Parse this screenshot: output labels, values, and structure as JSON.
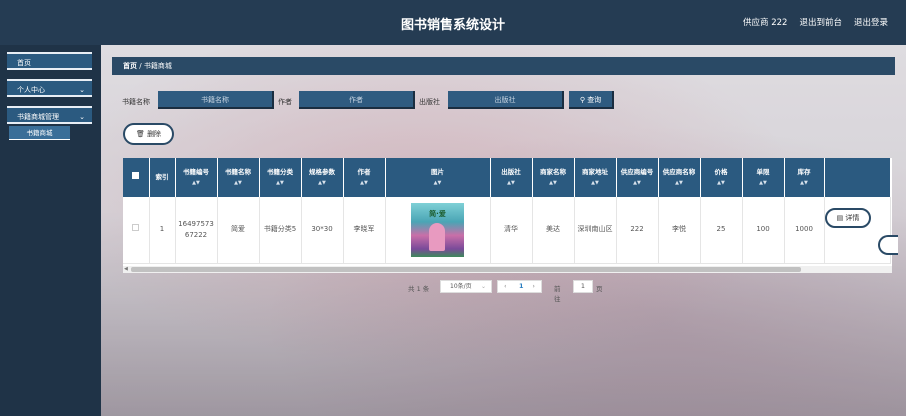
{
  "header": {
    "title": "图书销售系统设计",
    "user": "供应商 222",
    "backend_link": "退出到前台",
    "logout_link": "退出登录"
  },
  "sidebar": {
    "items": [
      {
        "label": "首页",
        "has_chevron": false
      },
      {
        "label": "个人中心",
        "has_chevron": true
      },
      {
        "label": "书籍商城管理",
        "has_chevron": true
      }
    ],
    "sub_items": [
      {
        "label": "书籍商城"
      }
    ]
  },
  "breadcrumb": {
    "home": "首页",
    "separator": "/",
    "current": "书籍商城"
  },
  "search": {
    "book_name_label": "书籍名称",
    "book_name_placeholder": "书籍名称",
    "author_label": "作者",
    "author_placeholder": "作者",
    "publisher_label": "出版社",
    "publisher_placeholder": "出版社",
    "search_button": "查询"
  },
  "actions": {
    "delete_button": "删除",
    "detail_button": "详情"
  },
  "table": {
    "columns": [
      {
        "label": "索引",
        "sortable": false
      },
      {
        "label": "书籍编号",
        "sortable": true
      },
      {
        "label": "书籍名称",
        "sortable": true
      },
      {
        "label": "书籍分类",
        "sortable": true
      },
      {
        "label": "规格参数",
        "sortable": true
      },
      {
        "label": "作者",
        "sortable": true
      },
      {
        "label": "图片",
        "sortable": true
      },
      {
        "label": "出版社",
        "sortable": true
      },
      {
        "label": "商家名称",
        "sortable": true
      },
      {
        "label": "商家地址",
        "sortable": true
      },
      {
        "label": "供应商编号",
        "sortable": true
      },
      {
        "label": "供应商名称",
        "sortable": true
      },
      {
        "label": "价格",
        "sortable": true
      },
      {
        "label": "单限",
        "sortable": true
      },
      {
        "label": "库存",
        "sortable": true
      }
    ],
    "rows": [
      {
        "index": "1",
        "book_no": "1649757367222",
        "book_name": "简爱",
        "category": "书籍分类5",
        "spec": "30*30",
        "author": "李晓军",
        "image_title": "简·爱",
        "publisher": "清华",
        "shop_name": "美达",
        "shop_address": "深圳南山区",
        "supplier_no": "222",
        "supplier_name": "李悦",
        "price": "25",
        "limit": "100",
        "stock": "1000"
      }
    ]
  },
  "pagination": {
    "total": "共 1 条",
    "page_size": "10条/页",
    "current_page": "1",
    "goto_label": "前往",
    "goto_value": "1",
    "page_suffix": "页"
  },
  "colors": {
    "header_bg": "#253c53",
    "sidebar_bg": "#1f3347",
    "accent": "#2b5a80"
  }
}
